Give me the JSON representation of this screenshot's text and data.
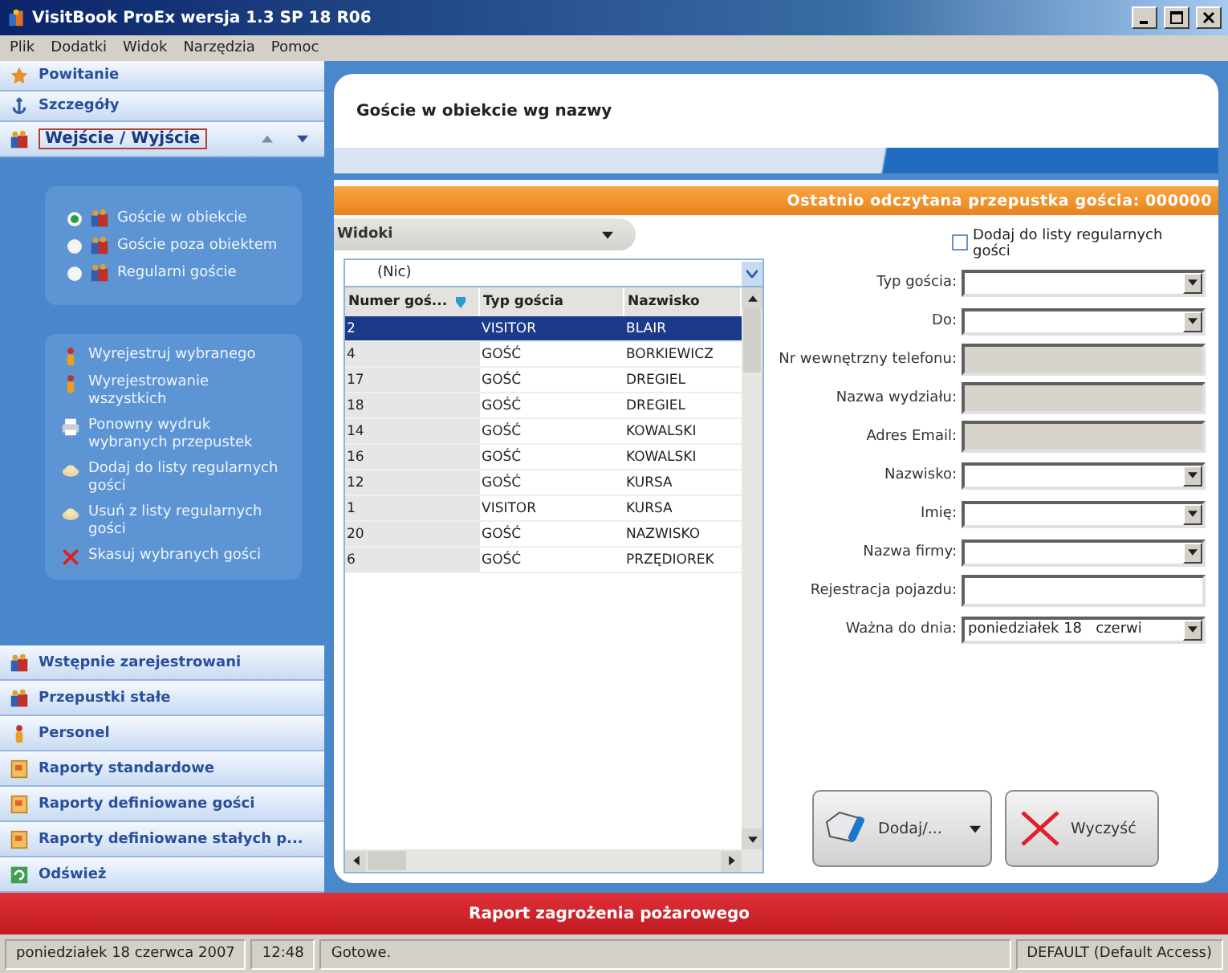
{
  "window": {
    "title": "VisitBook ProEx wersja 1.3 SP 18 R06"
  },
  "menu": [
    "Plik",
    "Dodatki",
    "Widok",
    "Narzędzia",
    "Pomoc"
  ],
  "sidebar": {
    "top_items": [
      {
        "label": "Powitanie",
        "kind": "welcome"
      },
      {
        "label": "Szczegóły",
        "kind": "details"
      }
    ],
    "current": {
      "label": "Wejście / Wyjście"
    },
    "views": [
      {
        "label": "Goście w obiekcie",
        "selected": true
      },
      {
        "label": "Goście poza obiektem",
        "selected": false
      },
      {
        "label": "Regularni goście",
        "selected": false
      }
    ],
    "actions": [
      {
        "label": "Wyrejestruj wybranego",
        "kind": "person"
      },
      {
        "label": "Wyrejestrowanie wszystkich",
        "kind": "person"
      },
      {
        "label": "Ponowny wydruk wybranych przepustek",
        "kind": "printer"
      },
      {
        "label": "Dodaj do listy regularnych gości",
        "kind": "cloud"
      },
      {
        "label": "Usuń z listy regularnych gości",
        "kind": "cloud"
      },
      {
        "label": "Skasuj wybranych gości",
        "kind": "delete"
      }
    ],
    "bottom_items": [
      {
        "label": "Wstępnie zarejestrowani",
        "kind": "group"
      },
      {
        "label": "Przepustki stałe",
        "kind": "group"
      },
      {
        "label": "Personel",
        "kind": "person"
      },
      {
        "label": "Raporty standardowe",
        "kind": "report"
      },
      {
        "label": "Raporty definiowane gości",
        "kind": "report"
      },
      {
        "label": "Raporty definiowane stałych p...",
        "kind": "report"
      },
      {
        "label": "Odśwież",
        "kind": "refresh"
      }
    ]
  },
  "page": {
    "title": "Goście w obiekcie wg nazwy",
    "last_pass": "Ostatnio odczytana przepustka gościa: 000000",
    "views_dropdown": "Widoki",
    "filter": "(Nic)"
  },
  "table": {
    "columns": [
      "Numer goś...",
      "Typ gościa",
      "Nazwisko"
    ],
    "rows": [
      {
        "cells": [
          "2",
          "VISITOR",
          "BLAIR"
        ],
        "selected": true
      },
      {
        "cells": [
          "4",
          "GOŚĆ",
          "BORKIEWICZ"
        ],
        "selected": false
      },
      {
        "cells": [
          "17",
          "GOŚĆ",
          "DREGIEL"
        ],
        "selected": false
      },
      {
        "cells": [
          "18",
          "GOŚĆ",
          "DREGIEL"
        ],
        "selected": false
      },
      {
        "cells": [
          "14",
          "GOŚĆ",
          "KOWALSKI"
        ],
        "selected": false
      },
      {
        "cells": [
          "16",
          "GOŚĆ",
          "KOWALSKI"
        ],
        "selected": false
      },
      {
        "cells": [
          "12",
          "GOŚĆ",
          "KURSA"
        ],
        "selected": false
      },
      {
        "cells": [
          "1",
          "VISITOR",
          "KURSA"
        ],
        "selected": false
      },
      {
        "cells": [
          "20",
          "GOŚĆ",
          "NAZWISKO"
        ],
        "selected": false
      },
      {
        "cells": [
          "6",
          "GOŚĆ",
          "PRZĘDIOREK"
        ],
        "selected": false
      }
    ]
  },
  "form": {
    "regular_checkbox": {
      "label": "Dodaj do listy regularnych gości",
      "checked": false
    },
    "fields": [
      {
        "label": "Typ gościa:",
        "kind": "combo"
      },
      {
        "label": "Do:",
        "kind": "combo"
      },
      {
        "label": "Nr wewnętrzny telefonu:",
        "kind": "readonly"
      },
      {
        "label": "Nazwa wydziału:",
        "kind": "readonly"
      },
      {
        "label": "Adres Email:",
        "kind": "readonly"
      },
      {
        "label": "Nazwisko:",
        "kind": "combo"
      },
      {
        "label": "Imię:",
        "kind": "combo"
      },
      {
        "label": "Nazwa firmy:",
        "kind": "combo"
      },
      {
        "label": "Rejestracja pojazdu:",
        "kind": "text"
      },
      {
        "label": "Ważna do dnia:",
        "kind": "combo",
        "value": "poniedziałek 18   czerwi"
      }
    ],
    "buttons": [
      {
        "label": "Dodaj/...",
        "kind": "add"
      },
      {
        "label": "Wyczyść",
        "kind": "clear"
      }
    ]
  },
  "alarm_bar": "Raport zagrożenia pożarowego",
  "status_bar": [
    "poniedziałek 18 czerwca 2007",
    "12:48",
    "Gotowe.",
    "DEFAULT (Default Access)"
  ]
}
